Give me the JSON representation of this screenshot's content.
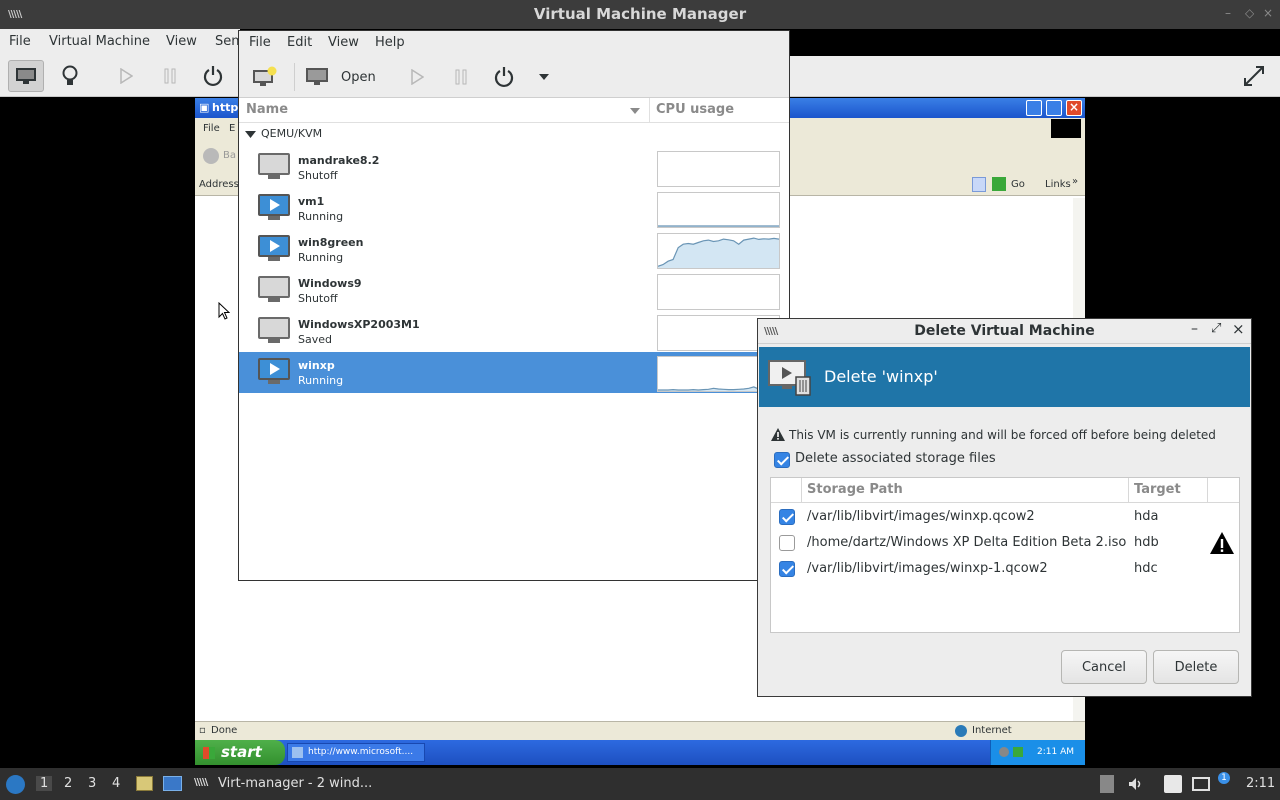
{
  "console": {
    "title": "Virtual Machine Manager",
    "menu": [
      "File",
      "Virtual Machine",
      "View",
      "Sen"
    ]
  },
  "guest": {
    "title": "http",
    "menu": [
      "File",
      "E"
    ],
    "back_label": "Ba",
    "address_label": "Address",
    "go_label": "Go",
    "links_label": "Links",
    "status_text": "Done",
    "zone_text": "Internet",
    "start_label": "start",
    "task_label": "http://www.microsoft....",
    "clock": "2:11 AM"
  },
  "manager": {
    "menu": [
      "File",
      "Edit",
      "View",
      "Help"
    ],
    "open_label": "Open",
    "col_name": "Name",
    "col_cpu": "CPU usage",
    "group": "QEMU/KVM",
    "vms": [
      {
        "name": "mandrake8.2",
        "status": "Shutoff",
        "running": false,
        "selected": false,
        "cpu": []
      },
      {
        "name": "vm1",
        "status": "Running",
        "running": true,
        "selected": false,
        "cpu": [
          3,
          3,
          3,
          3,
          3,
          3,
          3,
          3,
          3,
          3,
          3,
          3,
          3,
          3,
          3,
          3,
          3,
          3,
          3,
          3,
          3,
          3,
          3,
          3,
          3
        ]
      },
      {
        "name": "win8green",
        "status": "Running",
        "running": true,
        "selected": false,
        "cpu": [
          5,
          10,
          20,
          25,
          60,
          70,
          72,
          70,
          75,
          80,
          82,
          78,
          80,
          85,
          83,
          80,
          70,
          82,
          85,
          88,
          84,
          86,
          85,
          87,
          85
        ]
      },
      {
        "name": "Windows9",
        "status": "Shutoff",
        "running": false,
        "selected": false,
        "cpu": []
      },
      {
        "name": "WindowsXP2003M1",
        "status": "Saved",
        "running": false,
        "selected": false,
        "cpu": []
      },
      {
        "name": "winxp",
        "status": "Running",
        "running": true,
        "selected": true,
        "cpu": [
          3,
          3,
          3,
          4,
          3,
          3,
          3,
          4,
          3,
          4,
          5,
          8,
          6,
          5,
          4,
          4,
          5,
          6,
          8,
          12,
          6,
          5,
          5,
          6,
          5
        ]
      }
    ]
  },
  "dialog": {
    "window_title": "Delete Virtual Machine",
    "header_title": "Delete 'winxp'",
    "warning": "This VM is currently running and will be forced off before being deleted",
    "delete_storage_label": "Delete associated storage files",
    "delete_storage_checked": true,
    "col_path": "Storage Path",
    "col_target": "Target",
    "storage": [
      {
        "path": "/var/lib/libvirt/images/winxp.qcow2",
        "target": "hda",
        "checked": true,
        "warn": false
      },
      {
        "path": "/home/dartz/Windows XP Delta Edition Beta 2.iso",
        "target": "hdb",
        "checked": false,
        "warn": true
      },
      {
        "path": "/var/lib/libvirt/images/winxp-1.qcow2",
        "target": "hdc",
        "checked": true,
        "warn": false
      }
    ],
    "cancel_label": "Cancel",
    "delete_label": "Delete"
  },
  "panel": {
    "workspaces": [
      "1",
      "2",
      "3",
      "4"
    ],
    "active_workspace": "1",
    "task_label": "Virt-manager - 2 wind...",
    "clock": "2:11",
    "notification_count": "1"
  }
}
